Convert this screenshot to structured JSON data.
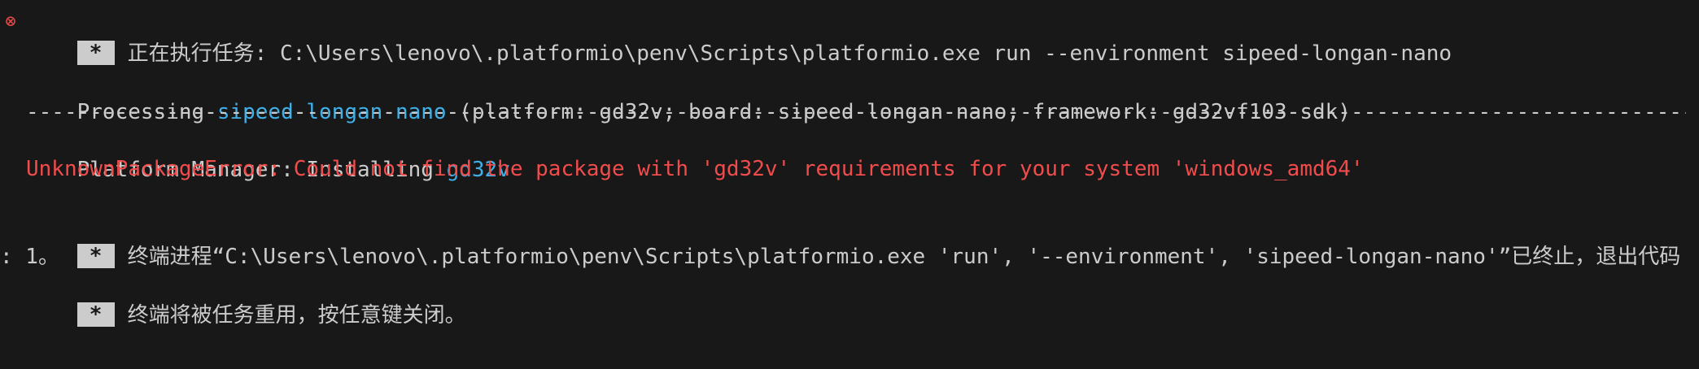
{
  "task": {
    "badge": "*",
    "label": "正在执行任务: ",
    "command": "C:\\Users\\lenovo\\.platformio\\penv\\Scripts\\platformio.exe run --environment sipeed-longan-nano"
  },
  "processing": {
    "prefix": "Processing ",
    "env_name": "sipeed-longan-nano",
    "details": " (platform: gd32v; board: sipeed-longan-nano; framework: gd32vf103-sdk)"
  },
  "separator": "---------------------------------------------------------------------------------------------------------------------------------------------------------------",
  "platform_manager": {
    "prefix": "Platform Manager: Installing ",
    "package": "gd32v"
  },
  "error": {
    "text": "UnknownPackageError: Could not find the package with 'gd32v' requirements for your system 'windows_amd64'"
  },
  "terminated": {
    "badge": "*",
    "text": "终端进程“C:\\Users\\lenovo\\.platformio\\penv\\Scripts\\platformio.exe 'run', '--environment', 'sipeed-longan-nano'”已终止，退出代码",
    "continuation": ": 1。"
  },
  "reuse": {
    "badge": "*",
    "text": "终端将被任务重用，按任意键关闭。"
  },
  "colors": {
    "background": "#181818",
    "text": "#cccccc",
    "accent_cyan": "#3fb0e8",
    "error_red": "#f14c4c"
  },
  "icons": {
    "task_status": "error-circle-icon"
  }
}
